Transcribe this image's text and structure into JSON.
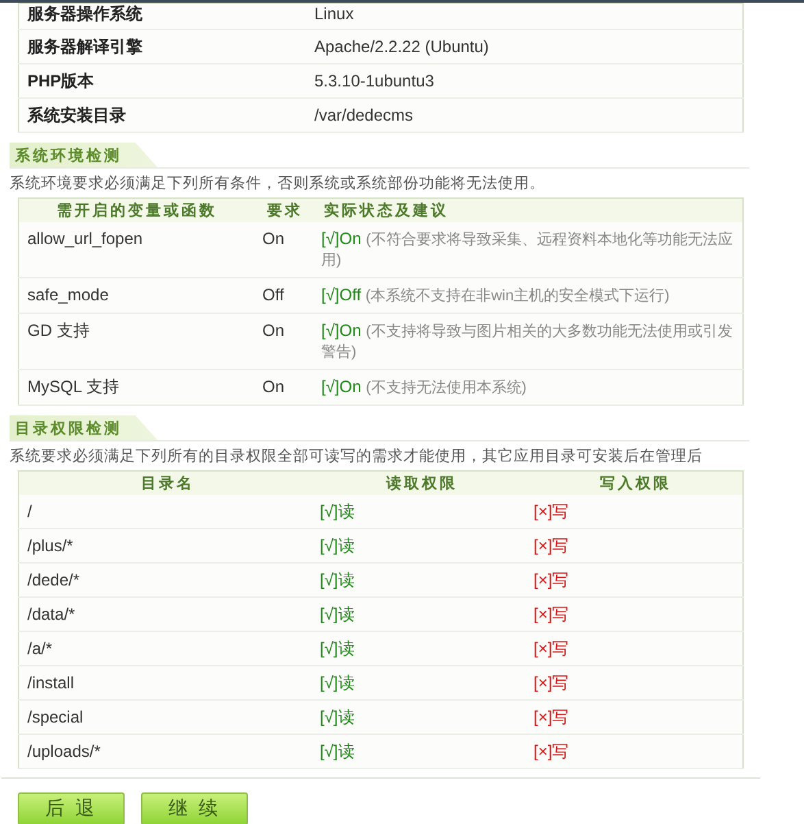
{
  "server_info": [
    {
      "label": "服务器操作系统",
      "value": "Linux"
    },
    {
      "label": "服务器解译引擎",
      "value": "Apache/2.2.22 (Ubuntu)"
    },
    {
      "label": "PHP版本",
      "value": "5.3.10-1ubuntu3"
    },
    {
      "label": "系统安装目录",
      "value": "/var/dedecms"
    }
  ],
  "env_check": {
    "title": "系统环境检测",
    "description": "系统环境要求必须满足下列所有条件，否则系统或系统部份功能将无法使用。",
    "columns": [
      "需开启的变量或函数",
      "要求",
      "实际状态及建议"
    ],
    "rows": [
      {
        "name": "allow_url_fopen",
        "required": "On",
        "pass": true,
        "mark": "[√]",
        "state": "On",
        "note": "(不符合要求将导致采集、远程资料本地化等功能无法应用)"
      },
      {
        "name": "safe_mode",
        "required": "Off",
        "pass": true,
        "mark": "[√]",
        "state": "Off",
        "note": "(本系统不支持在非win主机的安全模式下运行)"
      },
      {
        "name": "GD 支持",
        "required": "On",
        "pass": true,
        "mark": "[√]",
        "state": "On",
        "note": "(不支持将导致与图片相关的大多数功能无法使用或引发警告)"
      },
      {
        "name": "MySQL 支持",
        "required": "On",
        "pass": true,
        "mark": "[√]",
        "state": "On",
        "note": "(不支持无法使用本系统)"
      }
    ]
  },
  "dir_check": {
    "title": "目录权限检测",
    "description": "系统要求必须满足下列所有的目录权限全部可读写的需求才能使用，其它应用目录可安装后在管理后",
    "columns": [
      "目录名",
      "读取权限",
      "写入权限"
    ],
    "rows": [
      {
        "dir": "/",
        "read_ok": true,
        "read_mark": "[√]",
        "read": "读",
        "write_ok": false,
        "write_mark": "[×]",
        "write": "写"
      },
      {
        "dir": "/plus/*",
        "read_ok": true,
        "read_mark": "[√]",
        "read": "读",
        "write_ok": false,
        "write_mark": "[×]",
        "write": "写"
      },
      {
        "dir": "/dede/*",
        "read_ok": true,
        "read_mark": "[√]",
        "read": "读",
        "write_ok": false,
        "write_mark": "[×]",
        "write": "写"
      },
      {
        "dir": "/data/*",
        "read_ok": true,
        "read_mark": "[√]",
        "read": "读",
        "write_ok": false,
        "write_mark": "[×]",
        "write": "写"
      },
      {
        "dir": "/a/*",
        "read_ok": true,
        "read_mark": "[√]",
        "read": "读",
        "write_ok": false,
        "write_mark": "[×]",
        "write": "写"
      },
      {
        "dir": "/install",
        "read_ok": true,
        "read_mark": "[√]",
        "read": "读",
        "write_ok": false,
        "write_mark": "[×]",
        "write": "写"
      },
      {
        "dir": "/special",
        "read_ok": true,
        "read_mark": "[√]",
        "read": "读",
        "write_ok": false,
        "write_mark": "[×]",
        "write": "写"
      },
      {
        "dir": "/uploads/*",
        "read_ok": true,
        "read_mark": "[√]",
        "read": "读",
        "write_ok": false,
        "write_mark": "[×]",
        "write": "写"
      }
    ]
  },
  "buttons": [
    "后 退",
    "继 续"
  ]
}
